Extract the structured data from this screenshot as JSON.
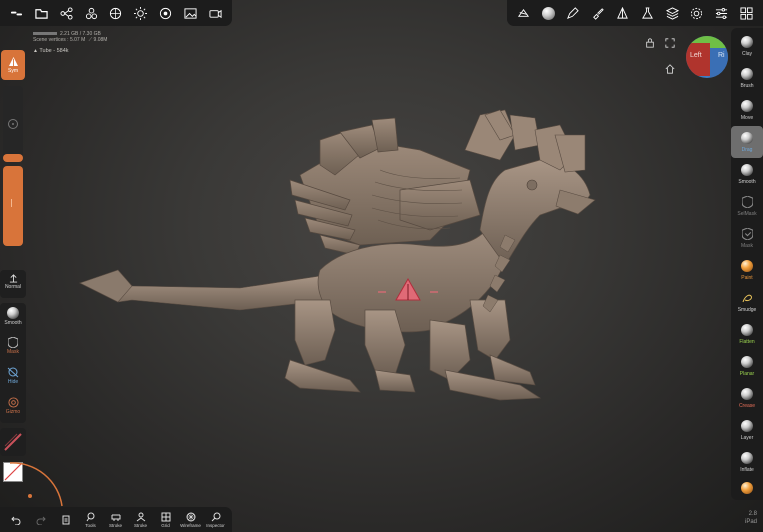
{
  "stats": {
    "memory": "2.21 GB / 7.30 GB",
    "scene_vertices": "Scene vertices : 5.07 M",
    "vertex_sub": "9.08M"
  },
  "mesh": {
    "name": "Tube - 584k"
  },
  "left": {
    "sym_label": "Sym",
    "normal_label": "Normal",
    "smooth_label": "Smooth",
    "mask_label": "Mask",
    "hide_label": "Hide",
    "gizmo_label": "Gizmo"
  },
  "right_tools": [
    {
      "label": "Clay"
    },
    {
      "label": "Brush"
    },
    {
      "label": "Move"
    },
    {
      "label": "Drag"
    },
    {
      "label": "Smooth"
    },
    {
      "label": "SelMask"
    },
    {
      "label": "Mask"
    },
    {
      "label": "Paint"
    },
    {
      "label": "Smudge"
    },
    {
      "label": "Flatten"
    },
    {
      "label": "Planar"
    },
    {
      "label": "Crease"
    },
    {
      "label": "Layer"
    },
    {
      "label": "Inflate"
    }
  ],
  "bottom_tools": [
    {
      "label": "Tools"
    },
    {
      "label": "Stroke"
    },
    {
      "label": "Stroke"
    },
    {
      "label": "Grid"
    },
    {
      "label": "Wireframe"
    },
    {
      "label": "Inspector"
    }
  ],
  "gizmo": {
    "face_left": "Left",
    "face_right": "Ri"
  },
  "version": {
    "number": "2.8",
    "device": "iPad"
  },
  "colors": {
    "accent": "#d8743a",
    "panel": "#1c1c1c",
    "model": "#8a7a6c",
    "selected_tool": "#6e6e6e"
  }
}
